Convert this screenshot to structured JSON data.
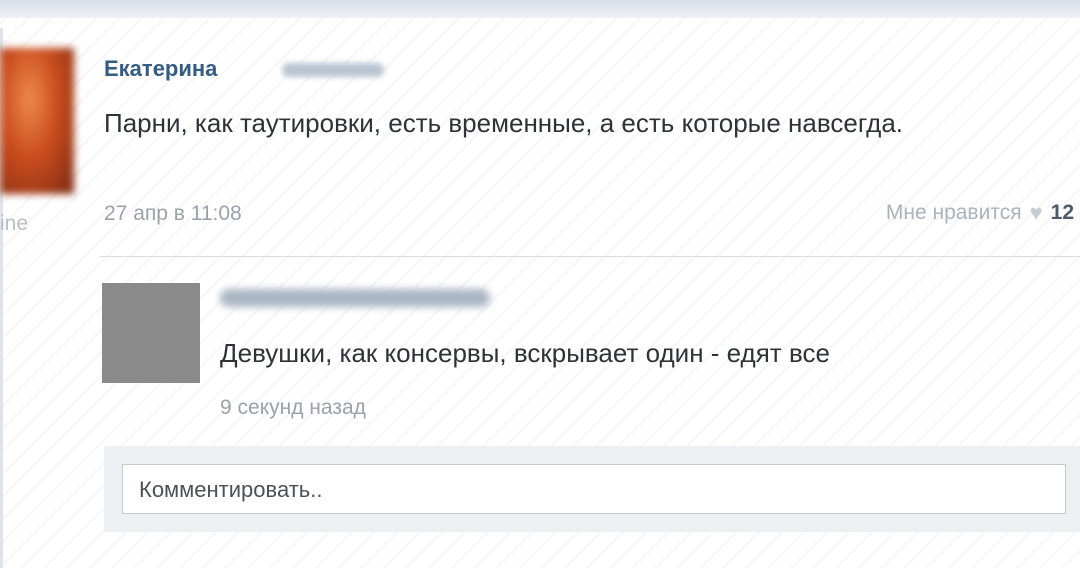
{
  "post": {
    "author": "Екатерина",
    "text": "Парни, как таутировки, есть временные, а есть которые навсегда.",
    "date": "27 апр в 11:08",
    "like_label": "Мне нравится",
    "like_count": "12",
    "online_fragment": "ine"
  },
  "reply": {
    "text": "Девушки, как консервы, вскрывает один - едят все",
    "time": "9 секунд назад"
  },
  "comment": {
    "placeholder": "Комментировать.."
  },
  "icons": {
    "like": "heart-icon"
  }
}
